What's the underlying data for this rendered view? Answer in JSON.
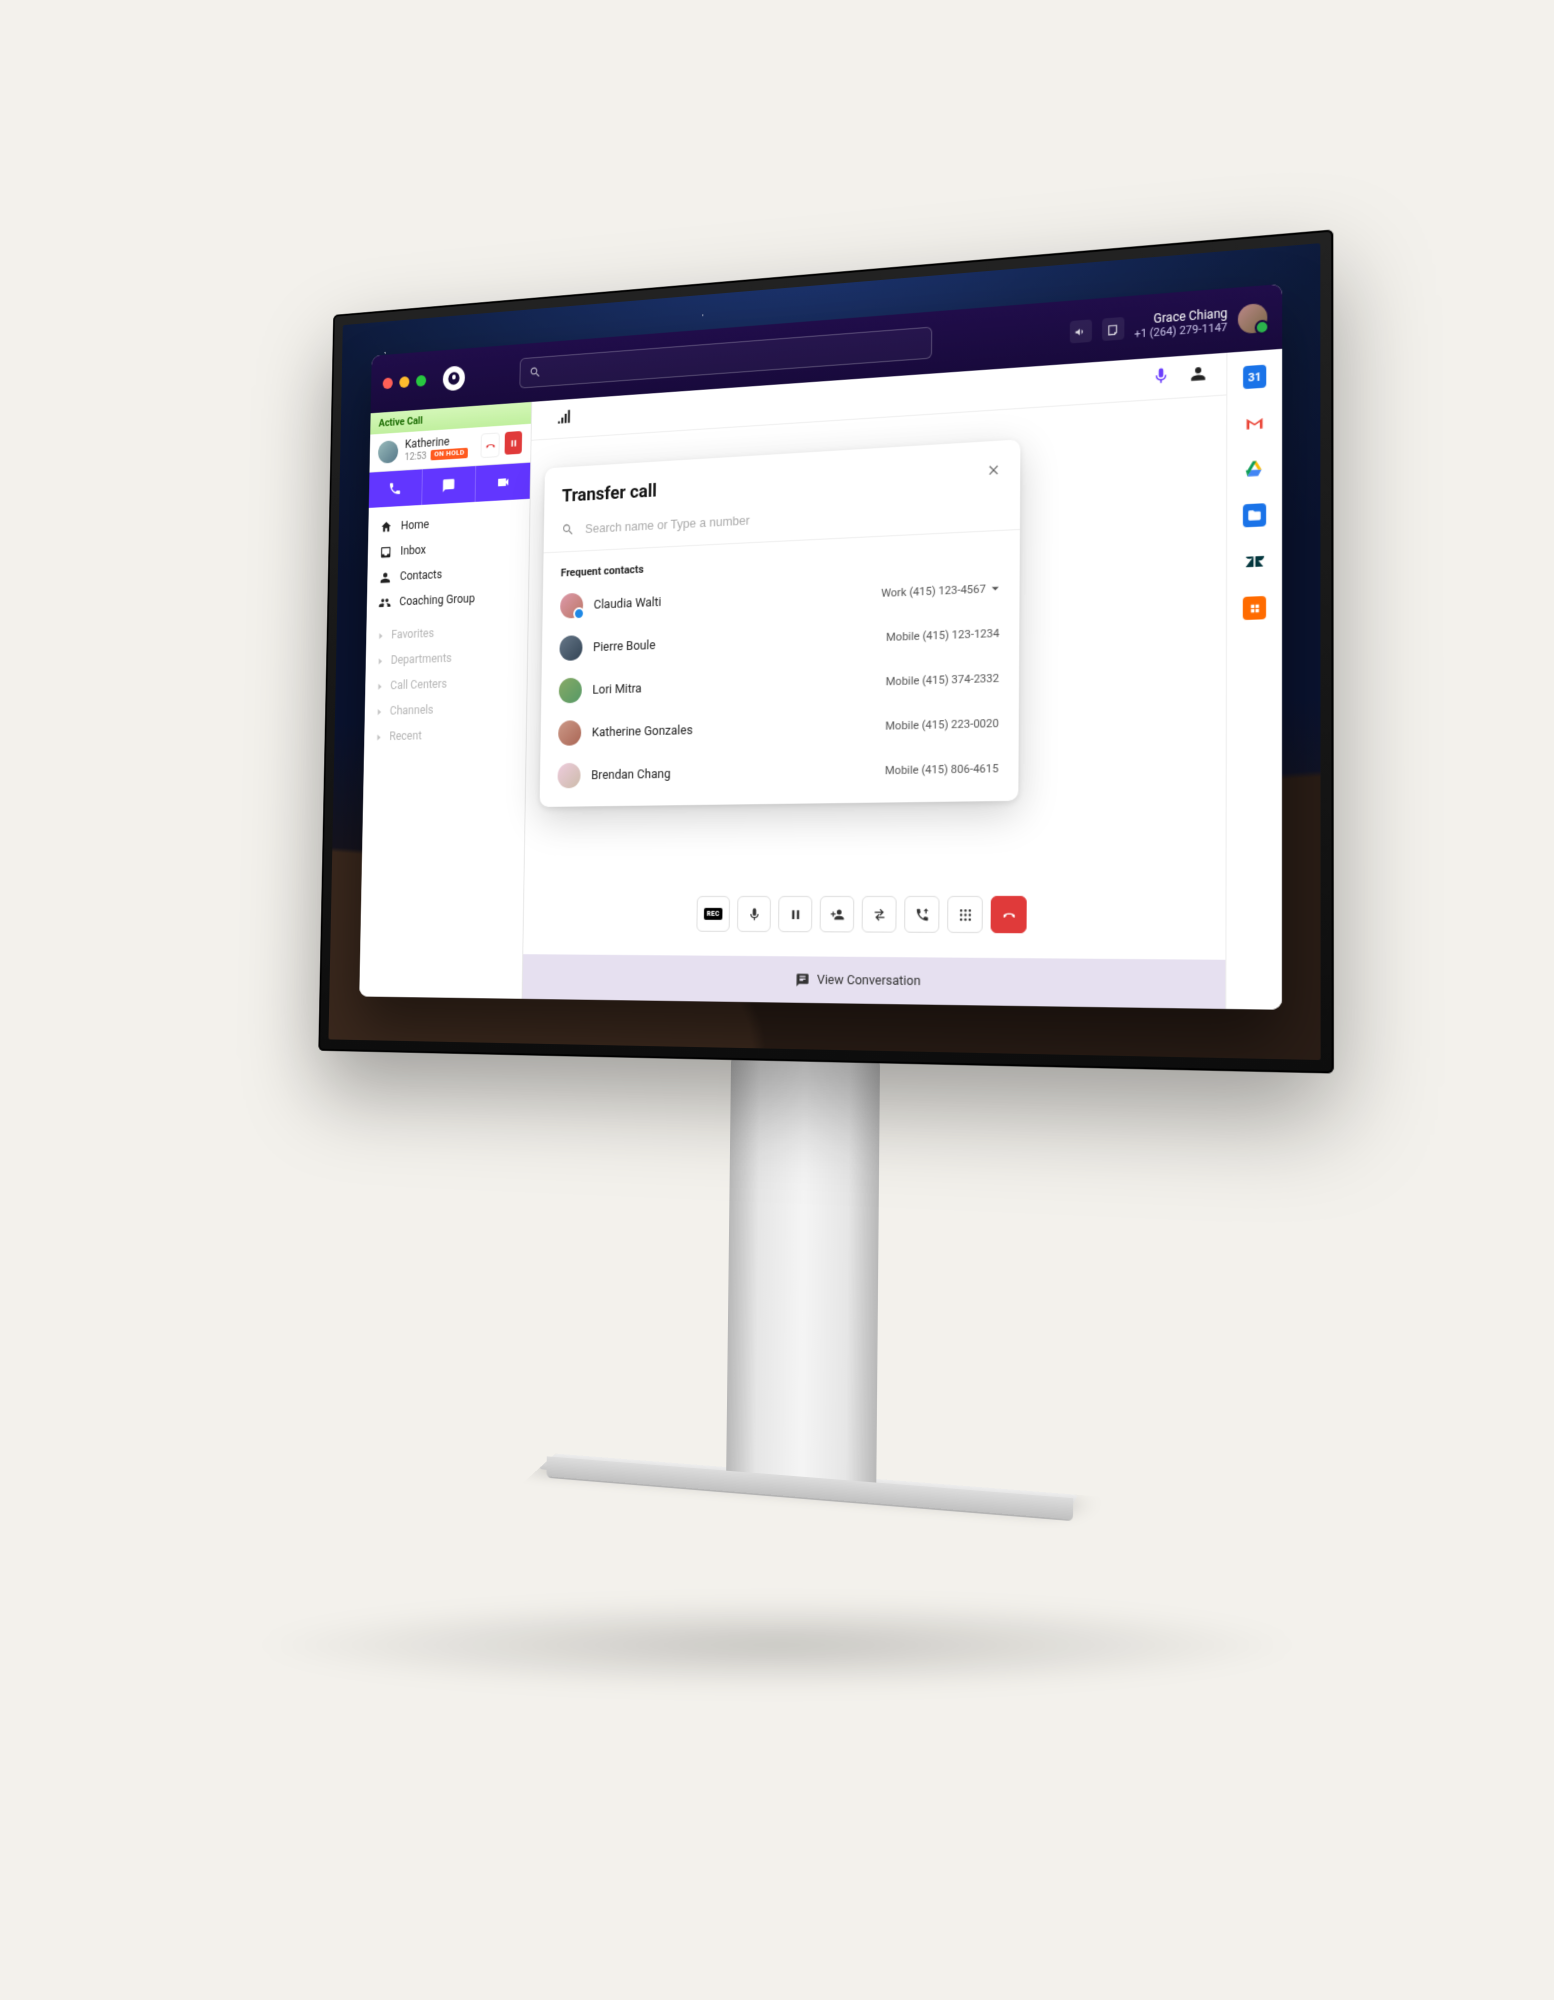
{
  "header": {
    "user_name": "Grace Chiang",
    "user_phone": "+1 (264) 279-1147"
  },
  "sidebar": {
    "active_call_label": "Active Call",
    "call": {
      "name": "Katherine",
      "time": "12:53",
      "on_hold_badge": "ON HOLD"
    },
    "nav": [
      {
        "label": "Home"
      },
      {
        "label": "Inbox"
      },
      {
        "label": "Contacts"
      },
      {
        "label": "Coaching Group"
      }
    ],
    "sections": [
      {
        "label": "Favorites"
      },
      {
        "label": "Departments"
      },
      {
        "label": "Call Centers"
      },
      {
        "label": "Channels"
      },
      {
        "label": "Recent"
      }
    ]
  },
  "transfer": {
    "title": "Transfer call",
    "search_placeholder": "Search name or Type a number",
    "frequent_label": "Frequent contacts",
    "contacts": [
      {
        "name": "Claudia Walti",
        "phone_label": "Work (415) 123-4567",
        "has_dropdown": true,
        "presence": "#1e88e5"
      },
      {
        "name": "Pierre Boule",
        "phone_label": "Mobile (415) 123-1234",
        "has_dropdown": false,
        "presence": ""
      },
      {
        "name": "Lori Mitra",
        "phone_label": "Mobile (415) 374-2332",
        "has_dropdown": false,
        "presence": ""
      },
      {
        "name": "Katherine Gonzales",
        "phone_label": "Mobile (415) 223-0020",
        "has_dropdown": false,
        "presence": ""
      },
      {
        "name": "Brendan Chang",
        "phone_label": "Mobile (415) 806-4615",
        "has_dropdown": false,
        "presence": ""
      }
    ]
  },
  "controls": {
    "rec_label": "REC"
  },
  "conversation": {
    "label": "View Conversation"
  },
  "rail": {
    "calendar_day": "31"
  }
}
